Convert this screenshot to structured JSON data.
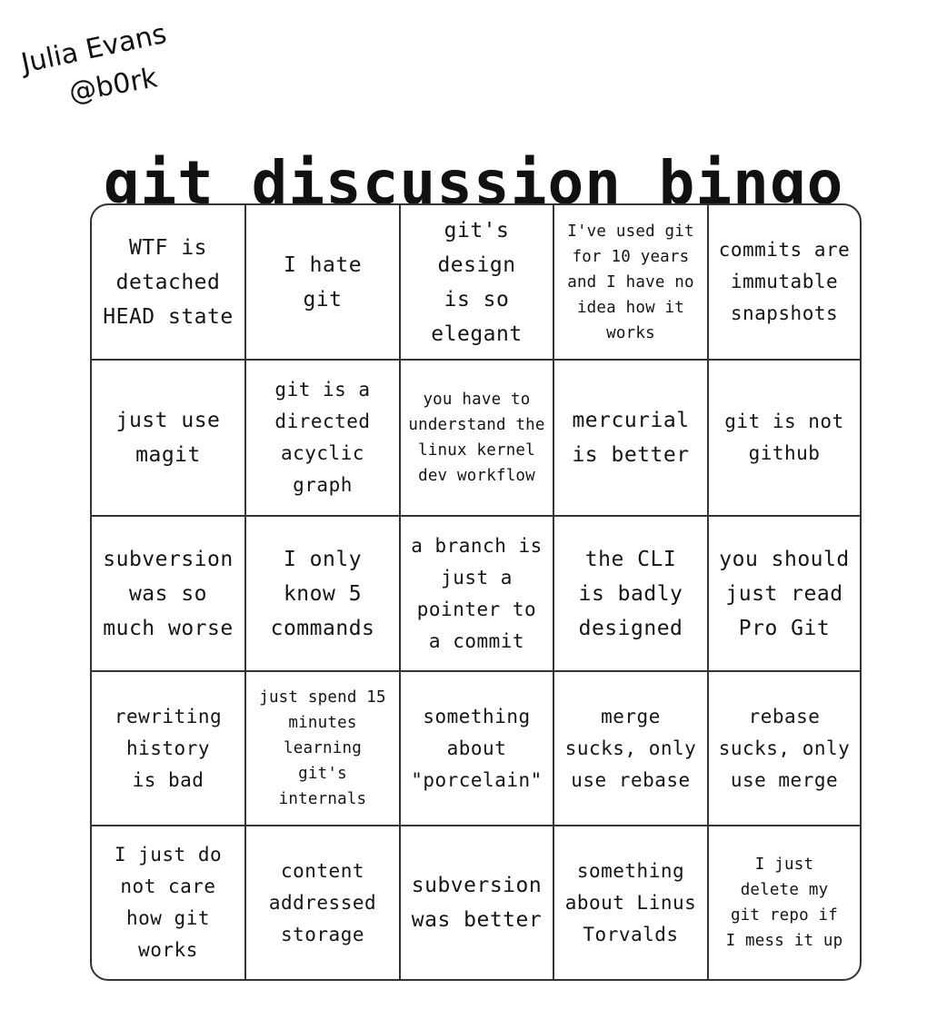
{
  "author": {
    "name": "Julia Evans",
    "handle": "@b0rk"
  },
  "title": "git discussion bingo",
  "board": {
    "rows": [
      [
        {
          "text": "WTF is\ndetached\nHEAD state",
          "size": "normal"
        },
        {
          "text": "I hate\ngit",
          "size": "normal"
        },
        {
          "text": "git's\ndesign\nis so\nelegant",
          "size": "normal"
        },
        {
          "text": "I've used git\nfor 10 years\nand I have no\nidea how it\nworks",
          "size": "small"
        },
        {
          "text": "commits are\nimmutable\nsnapshots",
          "size": "medium"
        }
      ],
      [
        {
          "text": "just use\nmagit",
          "size": "normal"
        },
        {
          "text": "git is a\ndirected\nacyclic\ngraph",
          "size": "medium"
        },
        {
          "text": "you have to\nunderstand the\nlinux kernel\ndev workflow",
          "size": "small"
        },
        {
          "text": "mercurial\nis better",
          "size": "normal"
        },
        {
          "text": "git is not\ngithub",
          "size": "medium"
        }
      ],
      [
        {
          "text": "subversion\nwas so\nmuch worse",
          "size": "normal"
        },
        {
          "text": "I only\nknow 5\ncommands",
          "size": "normal"
        },
        {
          "text": "a branch is\njust a\npointer to\na commit",
          "size": "medium"
        },
        {
          "text": "the CLI\nis badly\ndesigned",
          "size": "normal"
        },
        {
          "text": "you should\njust read\nPro Git",
          "size": "normal"
        }
      ],
      [
        {
          "text": "rewriting\nhistory\nis bad",
          "size": "medium"
        },
        {
          "text": "just spend 15\nminutes\nlearning\ngit's\ninternals",
          "size": "small"
        },
        {
          "text": "something\nabout\n\"porcelain\"",
          "size": "medium"
        },
        {
          "text": "merge\nsucks, only\nuse rebase",
          "size": "medium"
        },
        {
          "text": "rebase\nsucks, only\nuse merge",
          "size": "medium"
        }
      ],
      [
        {
          "text": "I just do\nnot care\nhow git\nworks",
          "size": "medium"
        },
        {
          "text": "content\naddressed\nstorage",
          "size": "medium"
        },
        {
          "text": "subversion\nwas better",
          "size": "normal"
        },
        {
          "text": "something\nabout Linus\nTorvalds",
          "size": "medium"
        },
        {
          "text": "I just\ndelete my\ngit repo if\nI mess it up",
          "size": "small"
        }
      ]
    ]
  }
}
